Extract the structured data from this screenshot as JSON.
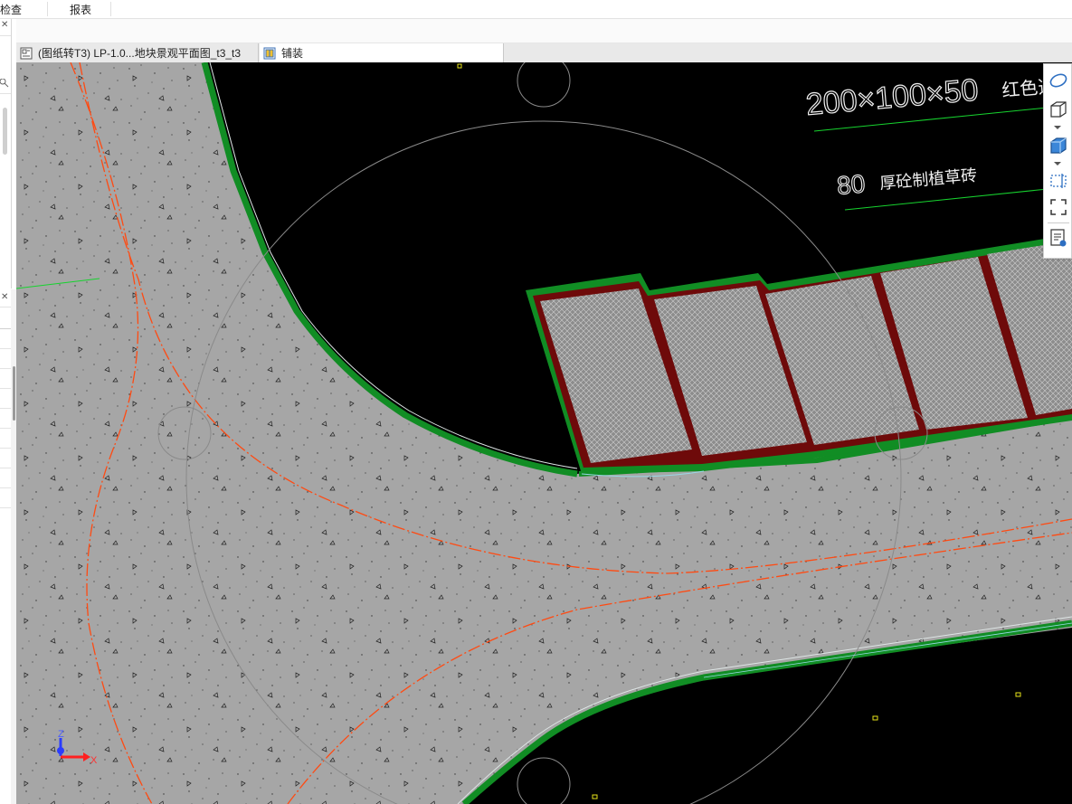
{
  "menu": {
    "items": [
      {
        "label": "检查"
      },
      {
        "label": "报表"
      }
    ]
  },
  "tabs": [
    {
      "label": "(图纸转T3) LP-1.0...地块景观平面图_t3_t3",
      "active": false
    },
    {
      "label": "铺装",
      "active": true
    }
  ],
  "drawing": {
    "annotations": {
      "paver_spec": "200×100×50",
      "paver_color": "红色透",
      "grass_brick": "80",
      "grass_brick_desc": "厚砼制植草砖"
    }
  },
  "axis": {
    "z_label": "Z",
    "x_label": "X"
  },
  "colors": {
    "background": "#000000",
    "pavement": "#a6a6a6",
    "curb": "#118d24",
    "centerline": "#ff4a12",
    "paver_frame": "#6e0a0a",
    "leader": "#17d32f"
  },
  "toolbar": {
    "icons": [
      "ellipse-view-icon",
      "box-view-icon",
      "shaded-box-icon",
      "selection-rect-icon",
      "fullscreen-icon",
      "properties-icon"
    ]
  }
}
